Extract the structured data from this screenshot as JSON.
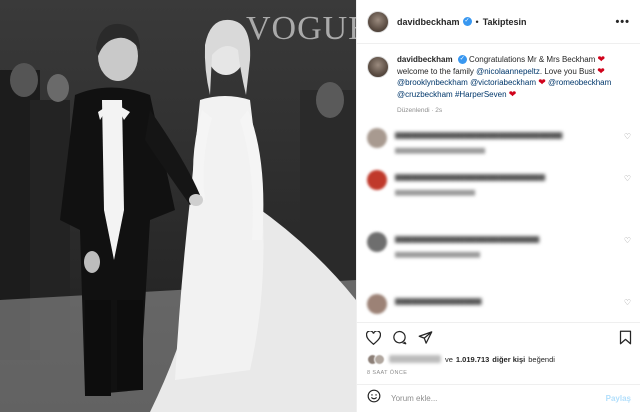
{
  "photo": {
    "magazine_text": "VOGUE"
  },
  "header": {
    "username": "davidbeckham",
    "separator": "•",
    "follow_status": "Takiptesin",
    "more": "•••"
  },
  "caption": {
    "username": "davidbeckham",
    "text_1": "Congratulations Mr & Mrs Beckham",
    "text_2": "welcome to the family",
    "mention_1": "@nicolaannepeltz",
    "text_3": ". Love you Bust",
    "mention_2": "@brooklynbeckham",
    "mention_3": "@victoriabeckham",
    "mention_4": "@romeobeckham",
    "mention_5": "@cruzbeckham",
    "hashtag": "#HarperSeven",
    "edited": "Düzenlendi · 2s"
  },
  "likes": {
    "connector": "ve",
    "count": "1.019.713",
    "other": "diğer kişi",
    "tail": "beğendi"
  },
  "timestamp": "8 SAAT ÖNCE",
  "add_comment": {
    "placeholder": "Yorum ekle...",
    "post": "Paylaş"
  },
  "icons": {
    "verified": "verified-badge-icon",
    "like": "heart-outline-icon",
    "comment": "comment-bubble-icon",
    "share": "paper-plane-icon",
    "save": "bookmark-icon",
    "emoji": "emoji-icon"
  },
  "colors": {
    "verified_blue": "#3897f0",
    "mention_blue": "#00376b",
    "heart_red": "#d0021b",
    "post_disabled": "#b2dffc"
  }
}
